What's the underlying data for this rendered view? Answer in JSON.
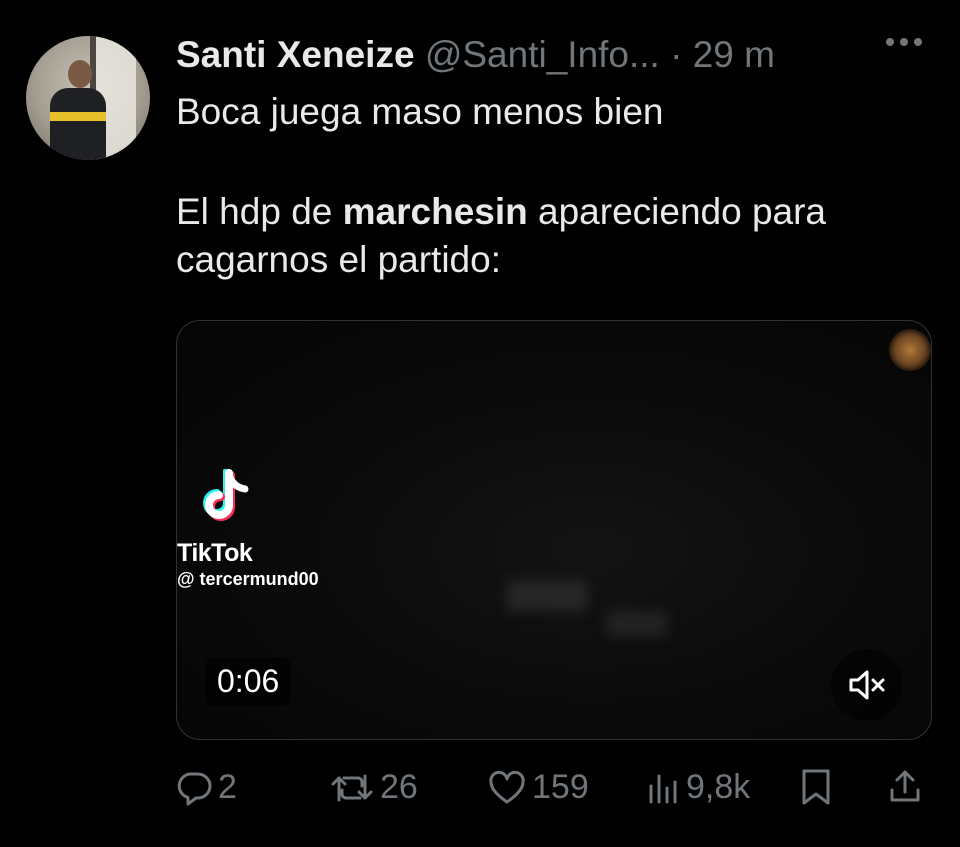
{
  "tweet": {
    "author_name": "Santi Xeneize",
    "author_handle": "@Santi_Info...",
    "separator": "·",
    "time": "29 m",
    "text_line1": "Boca juega maso menos bien",
    "text_pre": "El hdp de ",
    "text_bold": "marchesin",
    "text_post": " apareciendo para cagarnos el partido:"
  },
  "media": {
    "watermark_brand": "TikTok",
    "watermark_user": "@ tercermund00",
    "duration": "0:06",
    "muted": true
  },
  "actions": {
    "replies": "2",
    "retweets": "26",
    "likes": "159",
    "views": "9,8k"
  },
  "icons": [
    "more-icon",
    "reply-icon",
    "retweet-icon",
    "like-icon",
    "views-icon",
    "bookmark-icon",
    "share-icon",
    "mute-icon",
    "tiktok-logo-icon"
  ]
}
